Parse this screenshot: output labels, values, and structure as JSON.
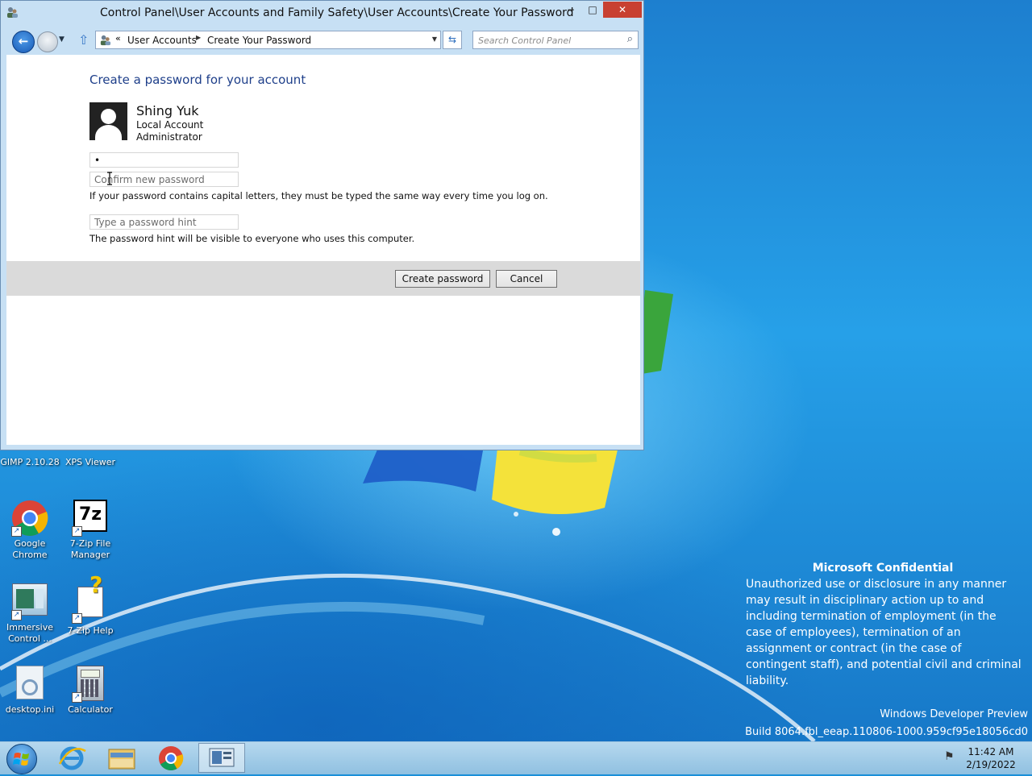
{
  "window": {
    "title": "Control Panel\\User Accounts and Family Safety\\User Accounts\\Create Your Password",
    "minimize": "−",
    "maximize": "□",
    "close": "✕"
  },
  "nav": {
    "crumb_overflow": "«",
    "crumbs": [
      "User Accounts",
      "Create Your Password"
    ],
    "search_placeholder": "Search Control Panel"
  },
  "page": {
    "title": "Create a password for your account",
    "user": {
      "name": "Shing Yuk",
      "account_type": "Local Account",
      "role": "Administrator"
    },
    "new_password_value": "•",
    "confirm_placeholder": "Confirm new password",
    "caps_note": "If your password contains capital letters, they must be typed the same way every time you log on.",
    "hint_placeholder": "Type a password hint",
    "hint_note": "The password hint will be visible to everyone who uses this computer.",
    "create_button": "Create password",
    "cancel_button": "Cancel"
  },
  "desktop": {
    "icons": [
      {
        "label": "GIMP 2.10.28"
      },
      {
        "label": "XPS Viewer"
      },
      {
        "label": "Google Chrome"
      },
      {
        "label": "7-Zip File Manager"
      },
      {
        "label": "Immersive Control ..."
      },
      {
        "label": "7-Zip Help"
      },
      {
        "label": "desktop.ini"
      },
      {
        "label": "Calculator"
      }
    ],
    "confidential_heading": "Microsoft Confidential",
    "confidential_body": "Unauthorized use or disclosure in any manner may result in disciplinary action up to and including termination of employment (in the case of employees), termination of an assignment or contract (in the case of contingent staff), and potential civil and criminal liability.",
    "watermark_line1": "Windows Developer Preview",
    "watermark_line2": "Build 8064.fbl_eeap.110806-1000.959cf95e18056cd0"
  },
  "taskbar": {
    "time": "11:42 AM",
    "date": "2/19/2022"
  },
  "colors": {
    "link_blue": "#1e3f8a",
    "close_red": "#c84031",
    "window_frame": "#c7e0f4"
  }
}
